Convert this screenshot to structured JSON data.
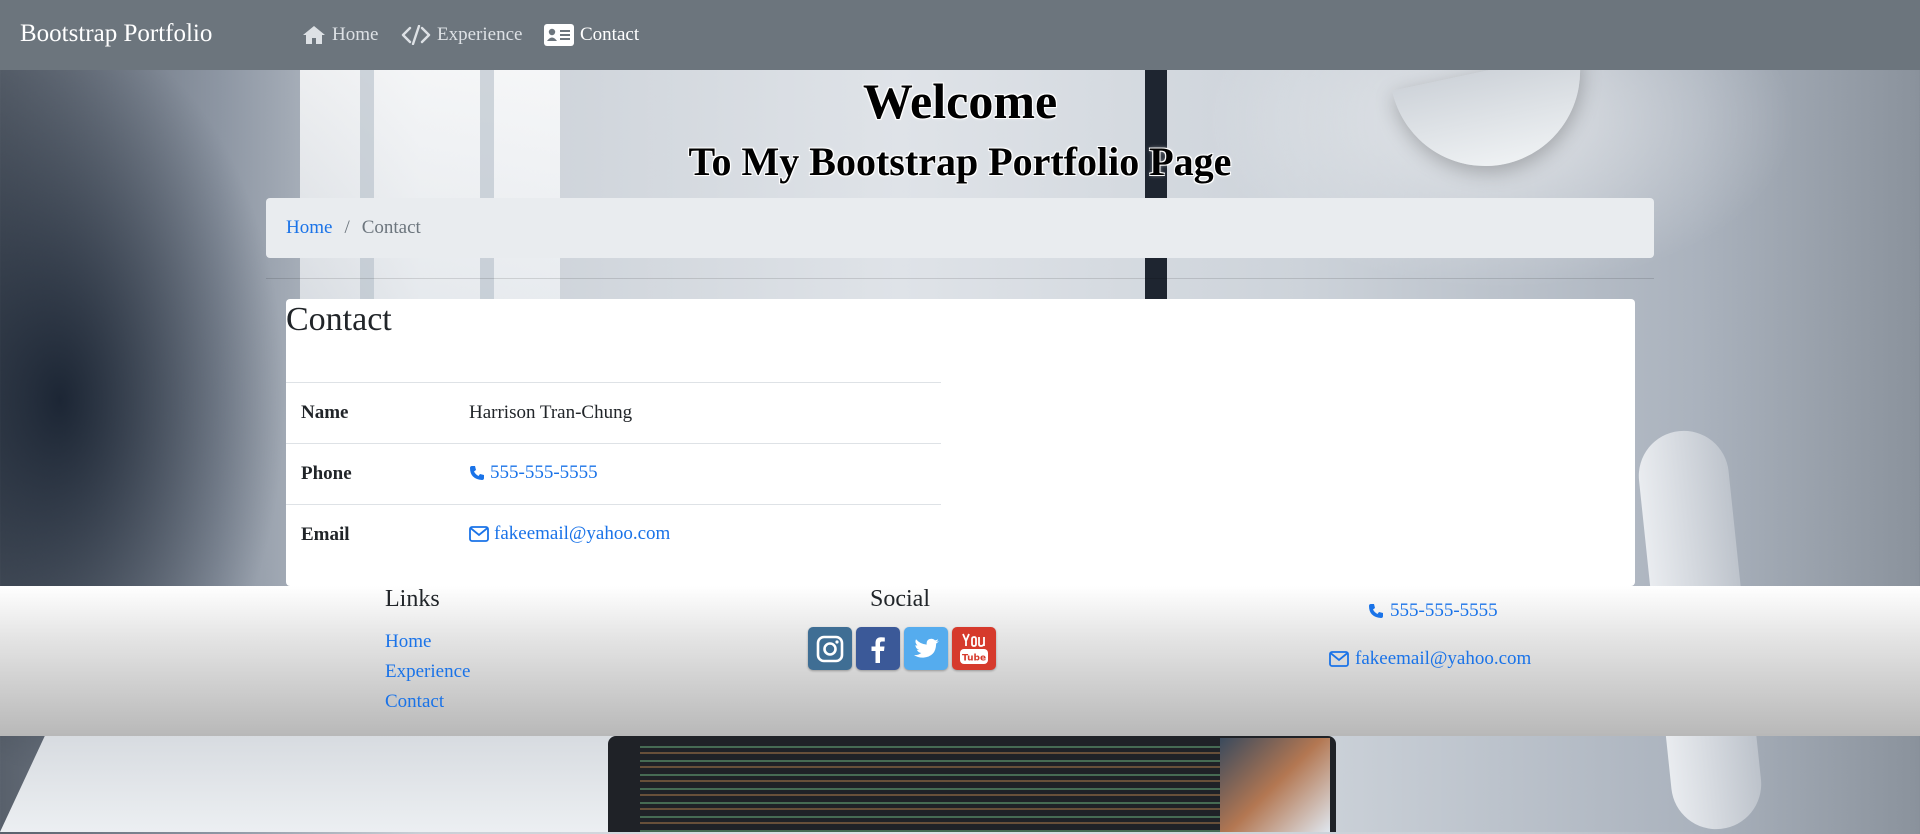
{
  "navbar": {
    "brand": "Bootstrap Portfolio",
    "links": [
      {
        "label": "Home",
        "icon": "home-icon",
        "active": false
      },
      {
        "label": "Experience",
        "icon": "code-icon",
        "active": false
      },
      {
        "label": "Contact",
        "icon": "id-card-icon",
        "active": true
      }
    ]
  },
  "hero": {
    "title": "Welcome",
    "subtitle": "To My Bootstrap Portfolio Page"
  },
  "breadcrumb": {
    "home": "Home",
    "separator": "/",
    "current": "Contact"
  },
  "contact": {
    "title": "Contact",
    "rows": [
      {
        "label": "Name",
        "value": "Harrison Tran-Chung"
      },
      {
        "label": "Phone",
        "value": "555-555-5555",
        "icon": "phone-icon"
      },
      {
        "label": "Email",
        "value": "fakeemail@yahoo.com",
        "icon": "envelope-icon"
      }
    ]
  },
  "footer": {
    "links_heading": "Links",
    "links": [
      "Home",
      "Experience",
      "Contact"
    ],
    "social_heading": "Social",
    "social": [
      {
        "name": "instagram-icon",
        "color": "#3f6e94"
      },
      {
        "name": "facebook-icon",
        "color": "#3b5998"
      },
      {
        "name": "twitter-icon",
        "color": "#55acee"
      },
      {
        "name": "youtube-icon",
        "color": "#d63a2c"
      }
    ],
    "phone": "555-555-5555",
    "email": "fakeemail@yahoo.com"
  },
  "colors": {
    "navbar_bg": "#6c757d",
    "link": "#1a73e8",
    "breadcrumb_bg": "#e9ecef"
  }
}
